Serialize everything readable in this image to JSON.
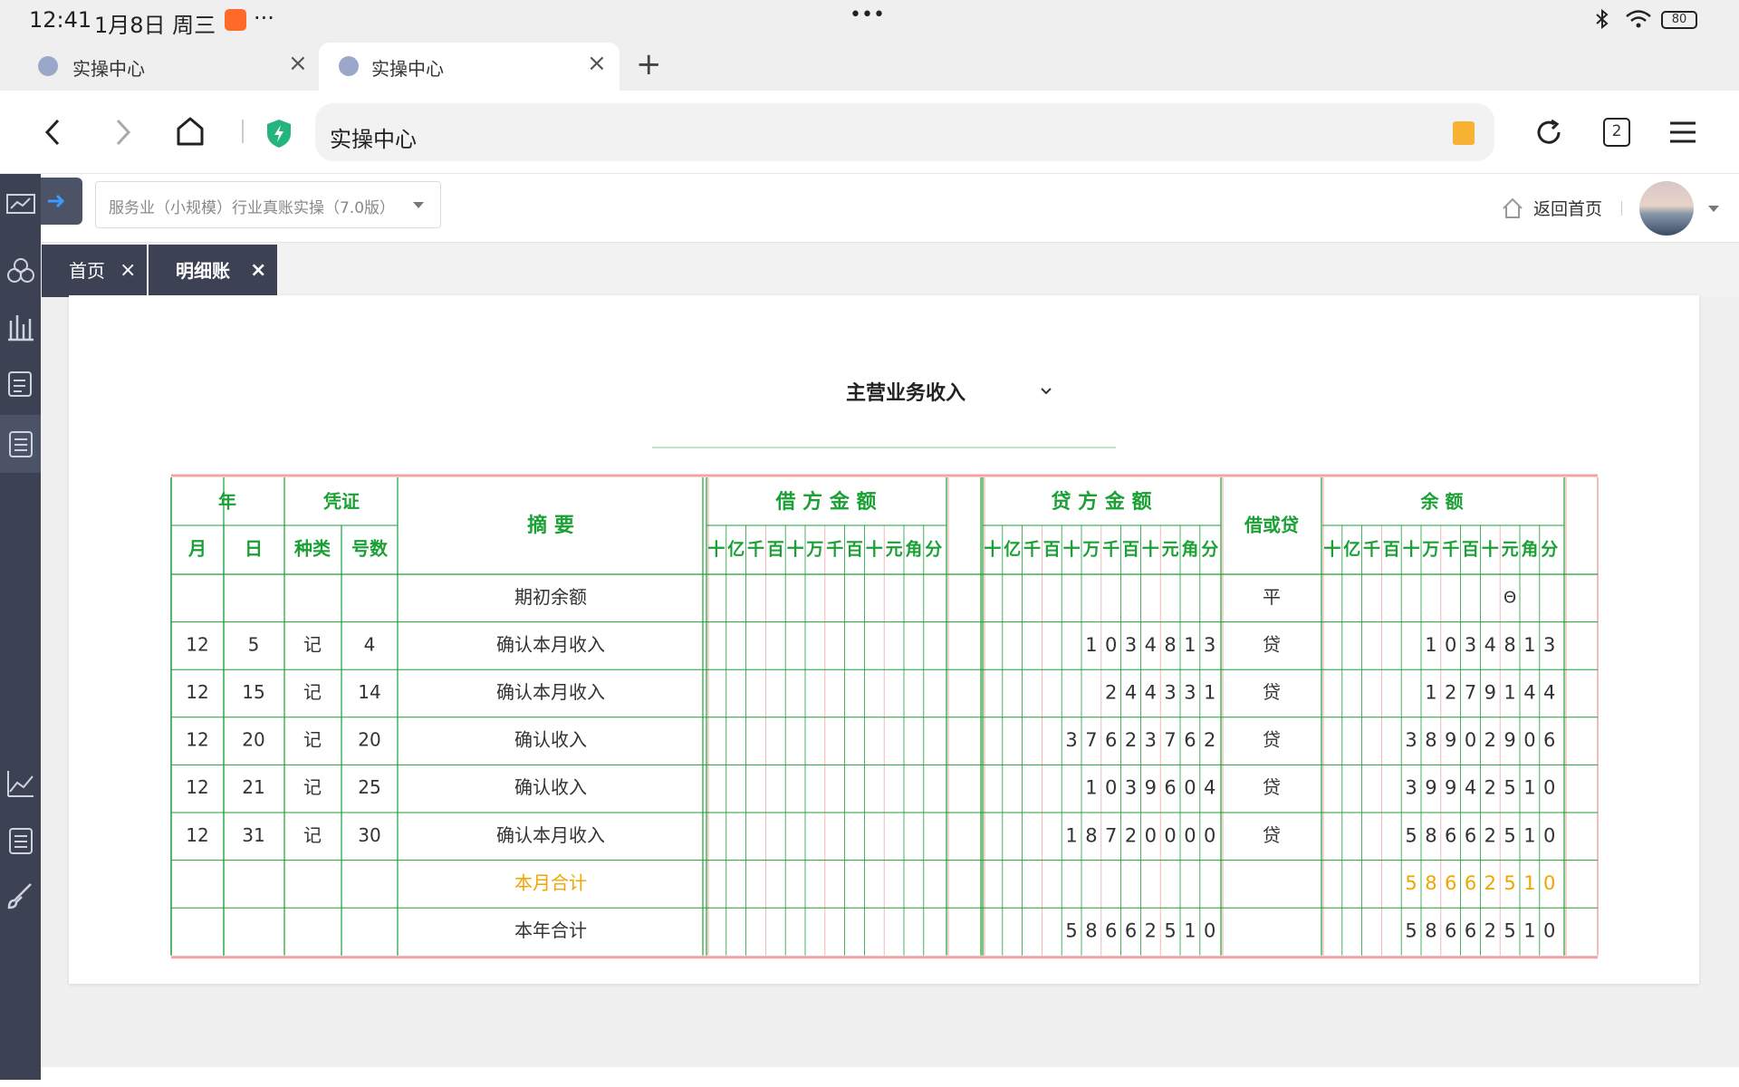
{
  "status": {
    "time": "12:41",
    "date": "1月8日 周三",
    "more": "···",
    "center_dots": "•••",
    "battery": "80"
  },
  "browser_tabs": [
    {
      "title": "实操中心",
      "active": false
    },
    {
      "title": "实操中心",
      "active": true
    }
  ],
  "address": {
    "text": "实操中心",
    "tab_count": "2"
  },
  "app": {
    "course_select": "服务业（小规模）行业真账实操（7.0版）",
    "home_link": "返回首页"
  },
  "app_tabs": [
    {
      "label": "首页",
      "active": false
    },
    {
      "label": "明细账",
      "active": true
    }
  ],
  "ledger": {
    "account": "主营业务收入",
    "headers": {
      "year": "年",
      "voucher": "凭证",
      "summary": "摘 要",
      "debit": "借 方 金 额",
      "credit": "贷 方 金 额",
      "dir": "借或贷",
      "balance": "余 额",
      "month": "月",
      "day": "日",
      "type": "种类",
      "num": "号数",
      "digits": [
        "十",
        "亿",
        "千",
        "百",
        "十",
        "万",
        "千",
        "百",
        "十",
        "元",
        "角",
        "分"
      ]
    },
    "rows": [
      {
        "month": "",
        "day": "",
        "type": "",
        "num": "",
        "summary": "期初余额",
        "debit": "",
        "credit": "",
        "dir": "平",
        "balance": "Θ",
        "highlight": false
      },
      {
        "month": "12",
        "day": "5",
        "type": "记",
        "num": "4",
        "summary": "确认本月收入",
        "debit": "",
        "credit": "1034813",
        "dir": "贷",
        "balance": "1034813",
        "highlight": false
      },
      {
        "month": "12",
        "day": "15",
        "type": "记",
        "num": "14",
        "summary": "确认本月收入",
        "debit": "",
        "credit": "244331",
        "dir": "贷",
        "balance": "1279144",
        "highlight": false
      },
      {
        "month": "12",
        "day": "20",
        "type": "记",
        "num": "20",
        "summary": "确认收入",
        "debit": "",
        "credit": "3762376 2",
        "dir": "贷",
        "balance": "3890290 6",
        "highlight": false
      },
      {
        "month": "12",
        "day": "21",
        "type": "记",
        "num": "25",
        "summary": "确认收入",
        "debit": "",
        "credit": "1039604",
        "dir": "贷",
        "balance": "3994251 0",
        "highlight": false
      },
      {
        "month": "12",
        "day": "31",
        "type": "记",
        "num": "30",
        "summary": "确认本月收入",
        "debit": "",
        "credit": "1872000 0",
        "dir": "贷",
        "balance": "5866251 0",
        "highlight": false
      },
      {
        "month": "",
        "day": "",
        "type": "",
        "num": "",
        "summary": "本月合计",
        "debit": "",
        "credit": "",
        "dir": "",
        "balance": "5866251 0",
        "highlight": true
      },
      {
        "month": "",
        "day": "",
        "type": "",
        "num": "",
        "summary": "本年合计",
        "debit": "",
        "credit": "5866251 0",
        "dir": "",
        "balance": "5866251 0",
        "highlight": false
      }
    ]
  },
  "colors": {
    "green": "#1aa034",
    "pink": "#f2a3a3",
    "orange": "#f0a500",
    "sidebar": "#3c4154"
  }
}
